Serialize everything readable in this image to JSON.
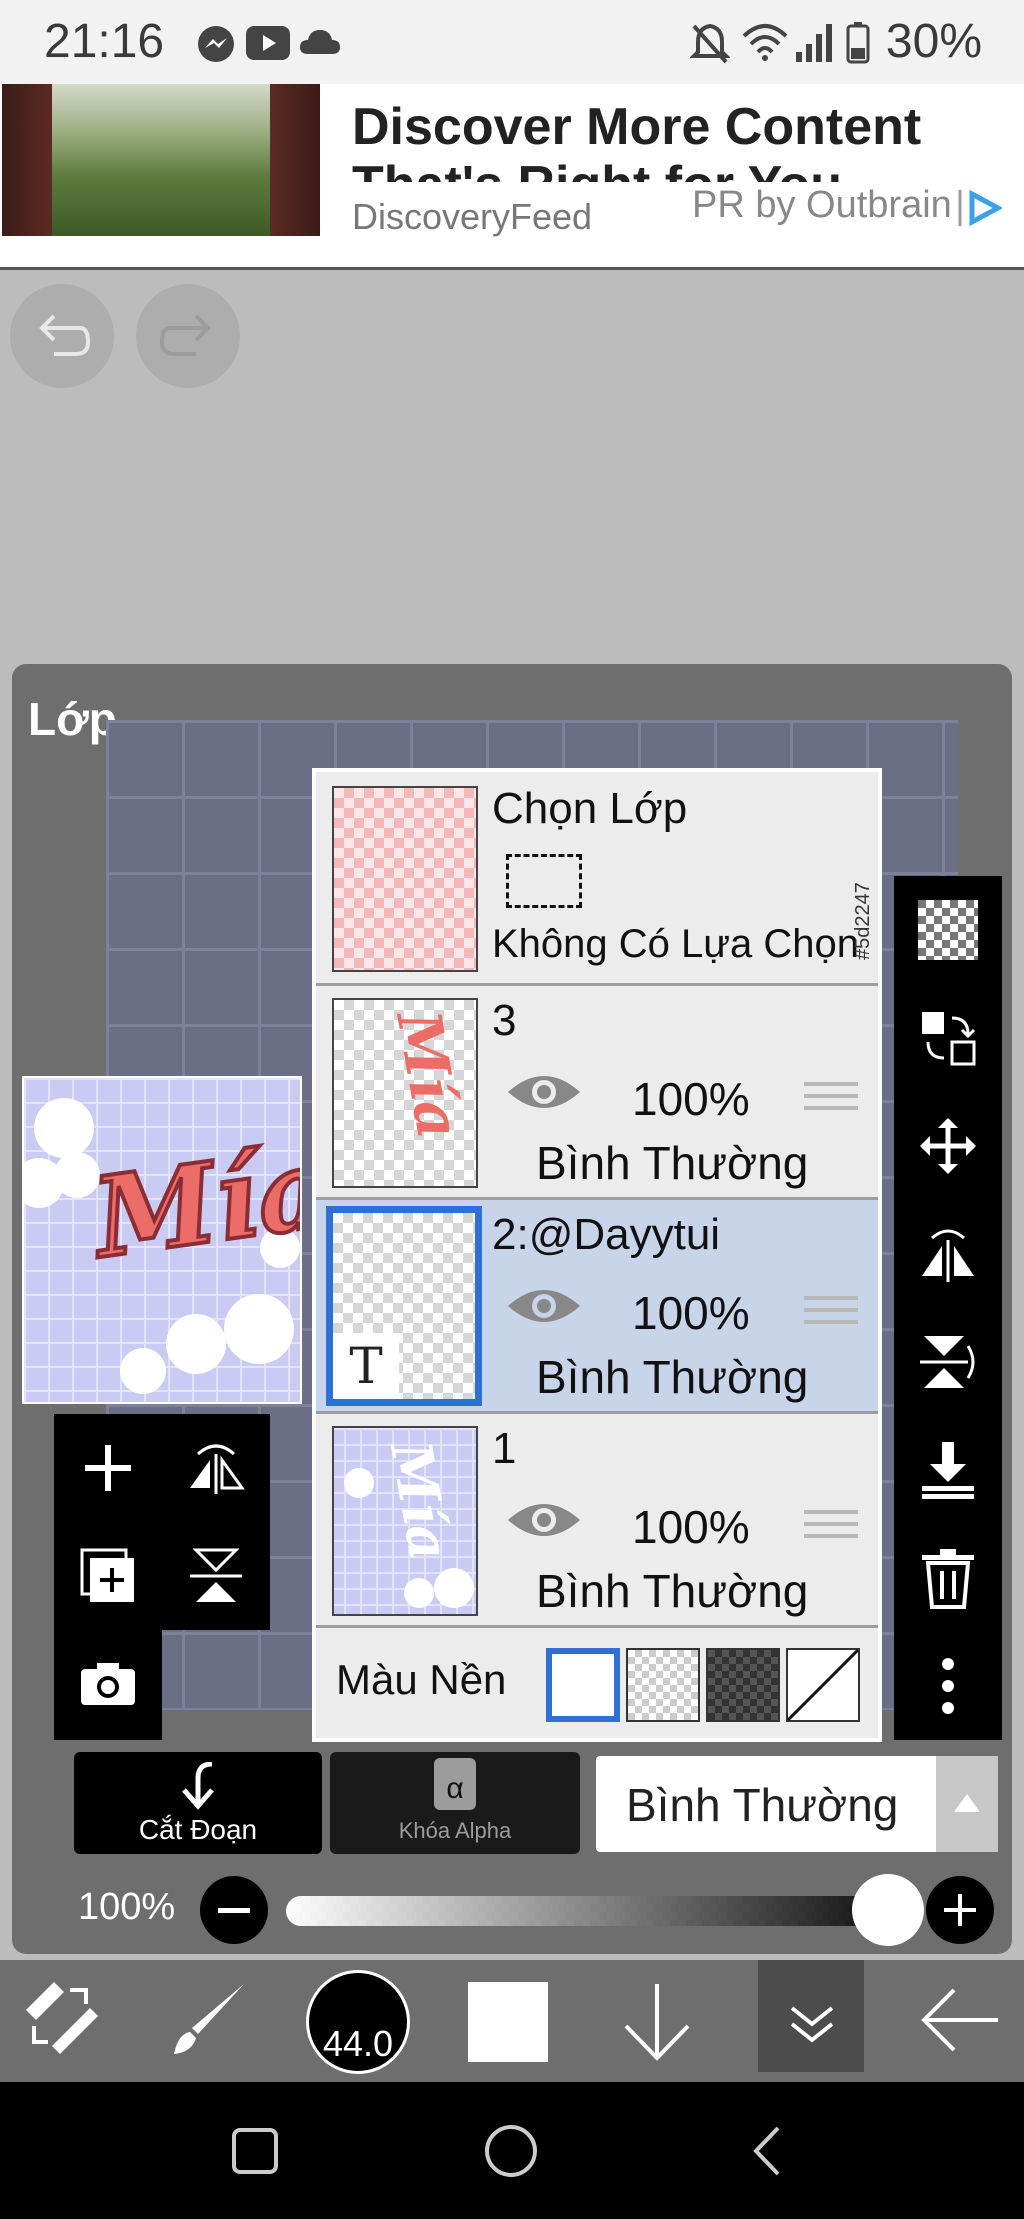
{
  "status": {
    "time": "21:16",
    "battery": "30%"
  },
  "ad": {
    "headline": "Discover More Content That's Right for You",
    "source": "DiscoveryFeed",
    "sponsor": "PR by Outbrain"
  },
  "panel": {
    "title": "Lớp",
    "selection_layer": {
      "name": "Chọn Lớp",
      "status": "Không Có Lựa Chọn"
    },
    "layers": [
      {
        "name": "3",
        "opacity": "100%",
        "blend": "Bình Thường",
        "selected": false
      },
      {
        "name": "2:@Dayytui",
        "opacity": "100%",
        "blend": "Bình Thường",
        "selected": true,
        "badge": "T"
      },
      {
        "name": "1",
        "opacity": "100%",
        "blend": "Bình Thường",
        "selected": false
      }
    ],
    "background_label": "Màu Nền",
    "color_code": "#5d2247",
    "clip_label": "Cắt Đoạn",
    "alpha_lock_label": "Khóa Alpha",
    "alpha_symbol": "α",
    "blend_mode": "Bình Thường",
    "opacity_label": "100%",
    "opacity_value": 1.0
  },
  "bottom": {
    "brush_size": "44.0"
  },
  "artwork": {
    "script_text": "Mía"
  },
  "colors": {
    "selected_row": "#c8d4ea",
    "accent_blue": "#2f6fd6",
    "panel_bg": "#6e6e6e"
  }
}
